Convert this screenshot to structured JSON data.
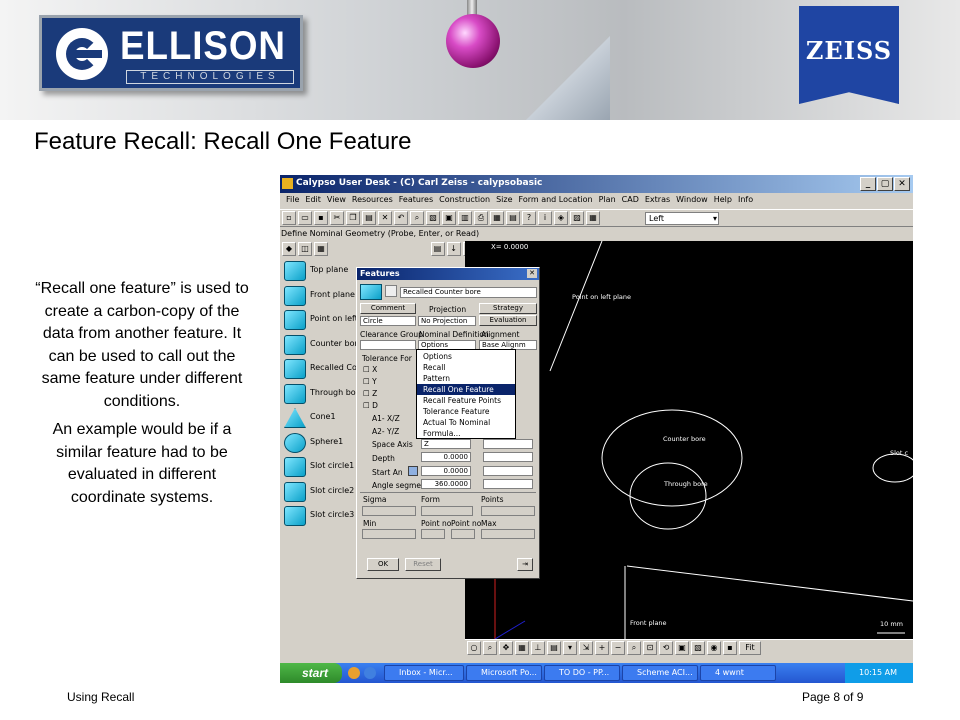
{
  "header": {
    "logo_name": "ELLISON",
    "logo_sub": "TECHNOLOGIES",
    "zeiss": "ZEISS"
  },
  "slide": {
    "title": "Feature Recall: Recall One Feature",
    "paragraphs": [
      "“Recall one feature” is used to create a carbon-copy of the data from another feature. It can be used to call out the same feature under different conditions.",
      "An example would be if a similar feature had to be evaluated in different coordinate systems."
    ],
    "footer_left": "Using Recall",
    "footer_right": "Page 8 of 9"
  },
  "app": {
    "title": "Calypso User Desk - (C) Carl Zeiss - calypsobasic",
    "menu": [
      "File",
      "Edit",
      "View",
      "Resources",
      "Features",
      "Construction",
      "Size",
      "Form and Location",
      "Plan",
      "CAD",
      "Extras",
      "Window",
      "Help",
      "Info"
    ],
    "view_combo": "Left",
    "define_line": "Define Nominal Geometry (Probe, Enter, or Read)",
    "features": [
      "Top plane",
      "Front plane",
      "Point on left",
      "Counter bore",
      "Recalled Co",
      "Through bor",
      "Cone1",
      "Sphere1",
      "Slot circle1",
      "Slot circle2",
      "Slot circle3"
    ]
  },
  "cad": {
    "coord": "X= 0.0000",
    "labels": [
      "Point on left plane",
      "Counter bore",
      "Through bore",
      "Slot c",
      "Front plane",
      "10 mm"
    ]
  },
  "dialog": {
    "title": "Features",
    "name": "Recalled Counter bore",
    "btn_comment": "Comment",
    "lbl_projection": "Projection",
    "btn_strategy": "Strategy",
    "combo_circle": "Circle",
    "combo_proj": "No Projection",
    "btn_evaluation": "Evaluation",
    "lbl_clearance": "Clearance Group",
    "lbl_nominal": "Nominal Definition",
    "lbl_alignment": "Alignment",
    "combo_options": "Options",
    "combo_align": "Base Alignm",
    "lbl_tolerance": "Tolerance For",
    "checks": [
      "X",
      "Y",
      "Z",
      "D"
    ],
    "lbl_a1": "A1- X/Z",
    "lbl_a2": "A2- Y/Z",
    "lbl_space": "Space Axis",
    "combo_z": "Z",
    "lbl_depth": "Depth",
    "val_depth": "0.0000",
    "lbl_start": "Start An",
    "val_start": "0.0000",
    "lbl_angle": "Angle segment",
    "val_angle": "360.0000",
    "lbl_sigma": "Sigma",
    "lbl_form": "Form",
    "lbl_points": "Points",
    "lbl_min": "Min",
    "lbl_pointno1": "Point no",
    "lbl_pointno2": "Point no",
    "lbl_max": "Max",
    "btn_ok": "OK",
    "btn_reset": "Reset",
    "dropdown": [
      "Options",
      "Recall",
      "Pattern",
      "Recall One Feature",
      "Recall Feature Points",
      "Tolerance Feature",
      "Actual To Nominal",
      "Formula..."
    ],
    "dropdown_selected": "Recall One Feature"
  },
  "taskbar": {
    "start": "start",
    "tasks": [
      "Inbox - Micr...",
      "Microsoft Po...",
      "TO DO - PP...",
      "Scheme ACI...",
      "4 wwnt"
    ],
    "time": "10:15 AM"
  }
}
